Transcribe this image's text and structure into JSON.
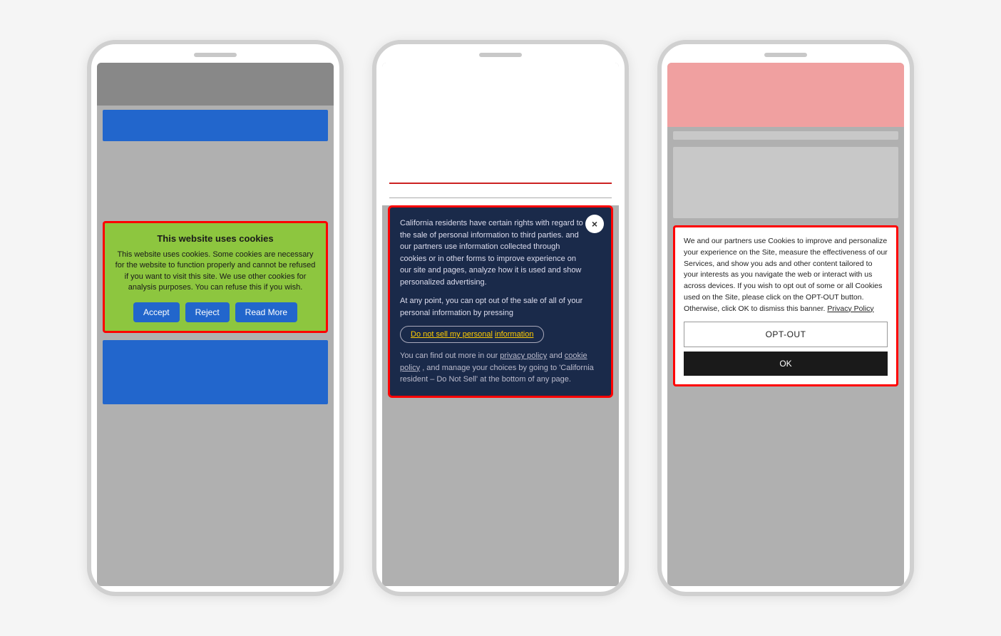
{
  "phone1": {
    "speaker": "speaker",
    "banner": {
      "title": "This website uses cookies",
      "body": "This website uses cookies. Some cookies are necessary for the website to function properly and cannot be refused if you want to visit this site. We use other cookies for analysis purposes. You can refuse this if you wish.",
      "accept_label": "Accept",
      "reject_label": "Reject",
      "read_more_label": "Read More"
    }
  },
  "phone2": {
    "banner": {
      "body1": "California residents have certain rights with regard to the sale of personal information to third parties.",
      "body2": "and our partners use information collected through cookies or in other forms to improve experience on our site and pages, analyze how it is used and show personalized advertising.",
      "opt_out_label": "Do not sell my personal",
      "opt_out_highlight": "information",
      "footer1": "At any point, you can opt out of the sale of all of your personal information by pressing",
      "footer2": "You can find out more in our",
      "privacy_link": "privacy policy",
      "and_text": "and",
      "cookie_link": "cookie policy",
      "footer3": ", and manage your choices by going to 'California resident – Do Not Sell' at the bottom of any page.",
      "close_icon": "×"
    }
  },
  "phone3": {
    "banner": {
      "body": "We and our partners use Cookies to improve and personalize your experience on the Site, measure the effectiveness of our Services, and show you ads and other content tailored to your interests as you navigate the web or interact with us across devices. If you wish to opt out of some or all Cookies used on the Site, please click on the OPT-OUT button. Otherwise, click OK to dismiss this banner.",
      "privacy_link": "Privacy Policy",
      "opt_out_label": "OPT-OUT",
      "ok_label": "OK"
    }
  }
}
